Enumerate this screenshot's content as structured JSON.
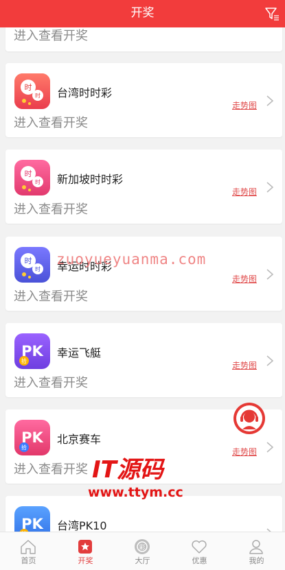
{
  "header": {
    "title": "开奖",
    "filter_icon": "filter-icon"
  },
  "list": {
    "items": [
      {
        "name": "",
        "cta": "进入查看开奖",
        "trend": "",
        "logo": "partial-card"
      },
      {
        "name": "台湾时时彩",
        "cta": "进入查看开奖",
        "trend": "走势图",
        "logo": "shi-balls-red"
      },
      {
        "name": "新加坡时时彩",
        "cta": "进入查看开奖",
        "trend": "走势图",
        "logo": "shi-balls-pink"
      },
      {
        "name": "幸运时时彩",
        "cta": "进入查看开奖",
        "trend": "走势图",
        "logo": "shi-balls-blue"
      },
      {
        "name": "幸运飞艇",
        "cta": "进入查看开奖",
        "trend": "走势图",
        "logo": "pk-purple"
      },
      {
        "name": "北京赛车",
        "cta": "进入查看开奖",
        "trend": "走势图",
        "logo": "pk-pink"
      },
      {
        "name": "台湾PK10",
        "cta": "",
        "trend": "",
        "logo": "pk-blue"
      }
    ]
  },
  "overlay": {
    "watermark_text": "zuoyueyuanma.com",
    "brand_logo_text": "IT源码",
    "brand_url": "www.ttym.cc",
    "support_icon": "customer-service-icon"
  },
  "tabbar": {
    "tabs": [
      {
        "label": "首页",
        "icon": "home-icon",
        "active": false
      },
      {
        "label": "开奖",
        "icon": "lottery-star-icon",
        "active": true
      },
      {
        "label": "大厅",
        "icon": "hall-icon",
        "active": false
      },
      {
        "label": "优惠",
        "icon": "heart-icon",
        "active": false
      },
      {
        "label": "我的",
        "icon": "user-icon",
        "active": false
      }
    ]
  },
  "colors": {
    "primary": "#f23c3c",
    "trend": "#e04a4a",
    "background": "#f2f2f2"
  }
}
